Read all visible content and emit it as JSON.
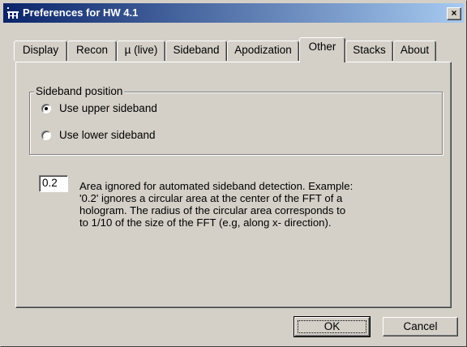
{
  "window": {
    "title": "Preferences for HW 4.1",
    "close_glyph": "×",
    "icon": "app-icon"
  },
  "tabs": [
    {
      "label": "Display",
      "active": false
    },
    {
      "label": "Recon",
      "active": false
    },
    {
      "label": "µ (live)",
      "active": false
    },
    {
      "label": "Sideband",
      "active": false
    },
    {
      "label": "Apodization",
      "active": false
    },
    {
      "label": "Other",
      "active": true
    },
    {
      "label": "Stacks",
      "active": false
    },
    {
      "label": "About",
      "active": false
    }
  ],
  "sideband": {
    "legend": "Sideband position",
    "options": [
      {
        "label": "Use upper sideband",
        "selected": true
      },
      {
        "label": "Use lower sideband",
        "selected": false
      }
    ]
  },
  "area": {
    "value": "0.2",
    "description_lines": [
      "Area ignored for automated sideband detection.  Example:",
      "'0.2' ignores a circular area at the center of the FFT of a",
      "hologram.  The radius of the circular area corresponds to",
      "to 1/10 of the size of the FFT (e.g, along x- direction)."
    ]
  },
  "buttons": {
    "ok": "OK",
    "cancel": "Cancel"
  },
  "colors": {
    "face": "#d4d0c8",
    "title_start": "#0a246a",
    "title_end": "#a6caf0"
  }
}
